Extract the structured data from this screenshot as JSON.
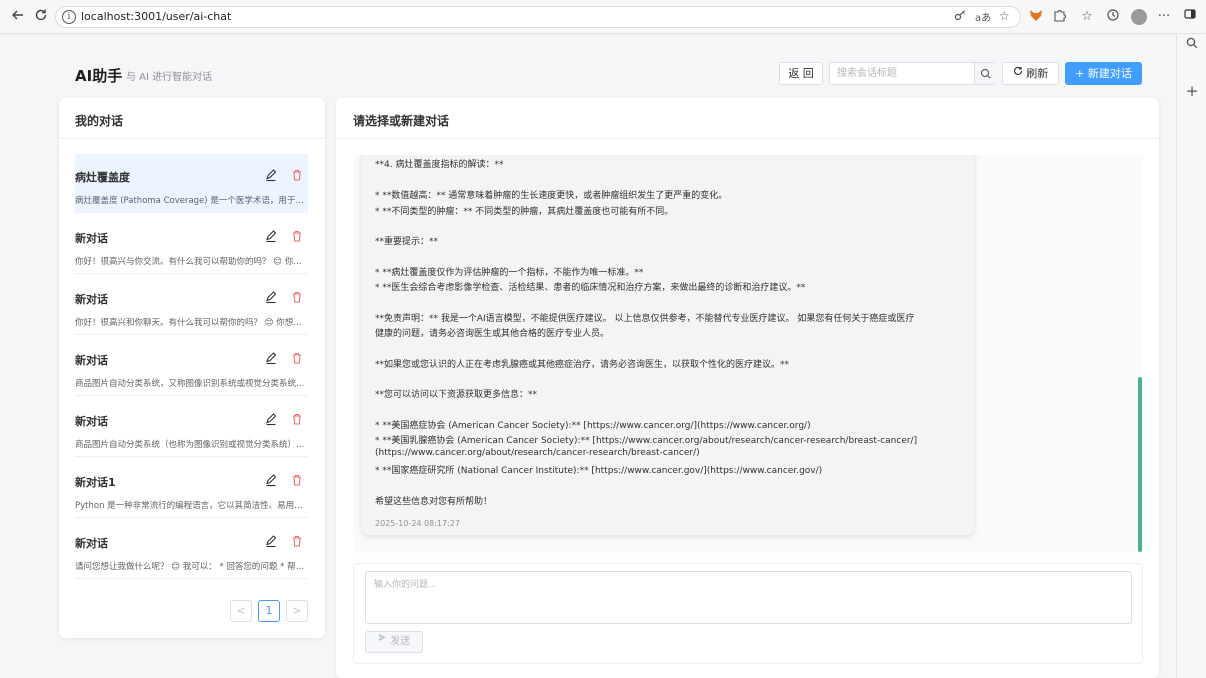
{
  "browser": {
    "url": "localhost:3001/user/ai-chat",
    "reader_label": "aあ"
  },
  "header": {
    "title": "AI助手",
    "subtitle": "与 AI 进行智能对话",
    "back_label": "返 回",
    "search_placeholder": "搜索会话标题",
    "refresh_label": "刷新",
    "new_chat_label": "新建对话"
  },
  "sidebar": {
    "title": "我的对话",
    "conversations": [
      {
        "title": "病灶覆盖度",
        "preview": "病灶覆盖度 (Pathoma Coverage) 是一个医学术语，用于评估...",
        "active": true
      },
      {
        "title": "新对话",
        "preview": "你好！很高兴与你交流。有什么我可以帮助你的吗？ 😊 你想...",
        "active": false
      },
      {
        "title": "新对话",
        "preview": "你好！很高兴和你聊天。有什么我可以帮你的吗？ 😊 你想聊...",
        "active": false
      },
      {
        "title": "新对话",
        "preview": "商品图片自动分类系统，又称图像识别系统或视觉分类系统，...",
        "active": false
      },
      {
        "title": "新对话",
        "preview": "商品图片自动分类系统（也称为图像识别或视觉分类系统）的...",
        "active": false
      },
      {
        "title": "新对话1",
        "preview": "Python 是一种非常流行的编程语言，它以其简洁性、易用性...",
        "active": false
      },
      {
        "title": "新对话",
        "preview": "请问您想让我做什么呢？ 😊 我可以： * 回答您的问题 * 帮您...",
        "active": false
      }
    ],
    "pagination": {
      "prev": "<",
      "current": "1",
      "next": ">"
    }
  },
  "chat": {
    "title": "请选择或新建对话",
    "message_lines": [
      "**4. 病灶覆盖度指标的解读：**",
      "",
      "* **数值越高：** 通常意味着肿瘤的生长速度更快，或者肿瘤组织发生了更严重的变化。",
      "* **不同类型的肿瘤：** 不同类型的肿瘤，其病灶覆盖度也可能有所不同。",
      "",
      "**重要提示：**",
      "",
      "* **病灶覆盖度仅作为评估肿瘤的一个指标，不能作为唯一标准。**",
      "* **医生会综合考虑影像学检查、活检结果、患者的临床情况和治疗方案，来做出最终的诊断和治疗建议。**",
      "",
      "**免责声明：** 我是一个AI语言模型，不能提供医疗建议。 以上信息仅供参考，不能替代专业医疗建议。 如果您有任何关于癌症或医疗",
      "健康的问题，请务必咨询医生或其他合格的医疗专业人员。",
      "",
      "**如果您或您认识的人正在考虑乳腺癌或其他癌症治疗，请务必咨询医生，以获取个性化的医疗建议。**",
      "",
      "**您可以访问以下资源获取更多信息：**",
      "",
      "* **美国癌症协会 (American Cancer Society):** [https://www.cancer.org/](https://www.cancer.org/)",
      "* **美国乳腺癌协会 (American Cancer Society):** [https://www.cancer.org/about/research/cancer-research/breast-cancer/]",
      "(https://www.cancer.org/about/research/cancer-research/breast-cancer/)",
      "* **国家癌症研究所 (National Cancer Institute):** [https://www.cancer.gov/](https://www.cancer.gov/)",
      "",
      "希望这些信息对您有所帮助！"
    ],
    "timestamp": "2025-10-24 08:17:27",
    "input_placeholder": "输入你的问题...",
    "send_label": "发送"
  },
  "colors": {
    "primary": "#409eff",
    "danger": "#f56c6c",
    "scrollbar": "#4caf93",
    "active_item_bg": "#ecf5ff"
  }
}
